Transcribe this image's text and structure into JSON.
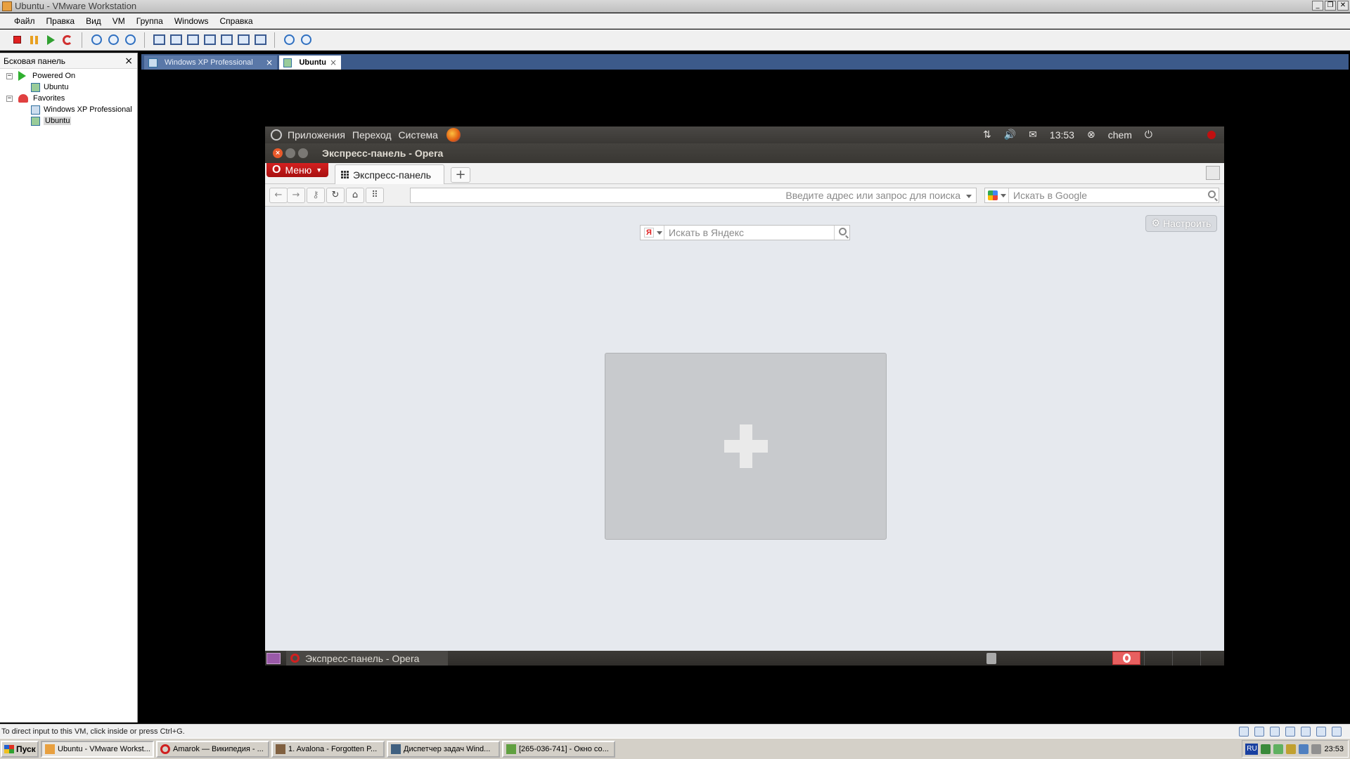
{
  "host": {
    "window_title": "Ubuntu - VMware Workstation",
    "menu": [
      "Файл",
      "Правка",
      "Вид",
      "VM",
      "Группа",
      "Windows",
      "Справка"
    ],
    "toolbar_icons": [
      "power-off-icon",
      "suspend-icon",
      "power-on-icon",
      "reset-icon",
      "snapshot-icon",
      "revert-snapshot-icon",
      "snapshot-manager-icon",
      "view-sidebar-icon",
      "full-screen-icon",
      "quick-switch-icon",
      "unity-icon",
      "summary-icon",
      "console-icon",
      "thumbnail-icon",
      "settings-icon",
      "devices-icon"
    ]
  },
  "sidebar": {
    "title": "Бсковая панель",
    "close": "×",
    "tree": [
      {
        "label": "Powered On",
        "toggle": "−"
      },
      {
        "label": "Ubuntu"
      },
      {
        "label": "Favorites",
        "toggle": "−"
      },
      {
        "label": "Windows XP Professional"
      },
      {
        "label": "Ubuntu"
      }
    ]
  },
  "vm_tabs": [
    {
      "label": "Windows XP Professional",
      "close": "×",
      "active": false
    },
    {
      "label": "Ubuntu",
      "close": "×",
      "active": true
    }
  ],
  "ubuntu": {
    "top_panel": {
      "menus": [
        "Приложения",
        "Переход",
        "Система"
      ],
      "clock": "13:53",
      "user": "chem"
    },
    "window_title": "Экспресс-панель - Opera",
    "opera": {
      "menu_label": "Меню",
      "tab_label": "Экспресс-панель",
      "new_tab": "+",
      "address_placeholder": "Введите адрес или запрос для поиска",
      "search_placeholder": "Искать в Google",
      "yandex_placeholder": "Искать в Яндекс",
      "configure_label": "Настроить",
      "speed_dial_add": "+"
    },
    "bottom_panel": {
      "task_label": "Экспресс-панель - Opera"
    }
  },
  "status_bar": {
    "hint": "To direct input to this VM, click inside or press Ctrl+G."
  },
  "taskbar": {
    "start_label": "Пуск",
    "tasks": [
      {
        "label": "Ubuntu - VMware Workst...",
        "pressed": true
      },
      {
        "label": "Amarok — Википедия - ...",
        "pressed": false
      },
      {
        "label": "1. Avalona - Forgotten P...",
        "pressed": false
      },
      {
        "label": "Диспетчер задач Wind...",
        "pressed": false
      },
      {
        "label": "[265-036-741] - Окно со...",
        "pressed": false
      }
    ],
    "language": "RU",
    "clock": "23:53"
  },
  "colors": {
    "vm_tabbar": "#3c5a8a",
    "opera_red": "#c41818",
    "ubuntu_panel": "#3f3d3a",
    "speed_dial_bg": "#e6e9ee"
  }
}
